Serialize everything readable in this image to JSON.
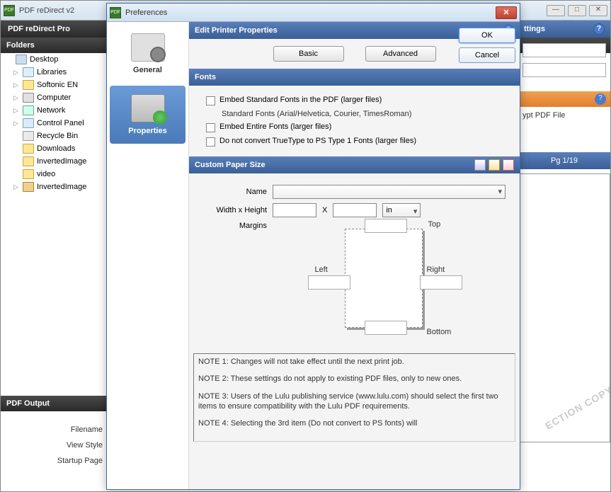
{
  "main": {
    "title": "PDF reDirect v2",
    "toolbar_title": "PDF reDirect Pro",
    "settings_hdr": "ttings"
  },
  "folders": {
    "header": "Folders",
    "items": [
      {
        "label": "Desktop",
        "cls": "desk",
        "tw": ""
      },
      {
        "label": "Libraries",
        "cls": "lib",
        "tw": "▷"
      },
      {
        "label": "Softonic EN",
        "cls": "",
        "tw": "▷"
      },
      {
        "label": "Computer",
        "cls": "comp",
        "tw": "▷"
      },
      {
        "label": "Network",
        "cls": "net",
        "tw": "▷"
      },
      {
        "label": "Control Panel",
        "cls": "cpl",
        "tw": "▷"
      },
      {
        "label": "Recycle Bin",
        "cls": "rec",
        "tw": ""
      },
      {
        "label": "Downloads",
        "cls": "",
        "tw": ""
      },
      {
        "label": "InvertedImage",
        "cls": "",
        "tw": ""
      },
      {
        "label": "video",
        "cls": "",
        "tw": ""
      },
      {
        "label": "InvertedImage",
        "cls": "zip",
        "tw": "▷"
      }
    ]
  },
  "output": {
    "header": "PDF Output",
    "filename": "Filename",
    "viewstyle": "View Style",
    "startup": "Startup Page"
  },
  "right": {
    "encrypt": "ypt PDF File",
    "pager": "Pg 1/19",
    "watermark": "ECTION COPY"
  },
  "dialog": {
    "title": "Preferences",
    "ok": "OK",
    "cancel": "Cancel",
    "nav_general": "General",
    "nav_properties": "Properties",
    "edit_hdr": "Edit Printer Properties",
    "tab_basic": "Basic",
    "tab_advanced": "Advanced",
    "fonts_hdr": "Fonts",
    "font_embed_std": "Embed Standard Fonts in the PDF (larger files)",
    "font_std_list": "Standard Fonts (Arial/Helvetica, Courier, TimesRoman)",
    "font_embed_entire": "Embed Entire Fonts (larger files)",
    "font_no_convert": "Do not convert TrueType to PS Type 1 Fonts (larger files)",
    "paper_hdr": "Custom Paper Size",
    "lbl_name": "Name",
    "lbl_wh": "Width x Height",
    "lbl_x": "X",
    "lbl_unit": "in",
    "lbl_margins": "Margins",
    "lbl_top": "Top",
    "lbl_left": "Left",
    "lbl_right": "Right",
    "lbl_bottom": "Bottom",
    "note1": "NOTE 1: Changes will not take effect until the next print job.",
    "note2": "NOTE 2: These settings do not apply to existing PDF files, only to new ones.",
    "note3": "NOTE 3: Users of the Lulu publishing service (www.lulu.com) should select the first two items to ensure compatibility with the Lulu PDF requirements.",
    "note4": "NOTE 4: Selecting the 3rd item (Do not convert to PS fonts) will"
  }
}
